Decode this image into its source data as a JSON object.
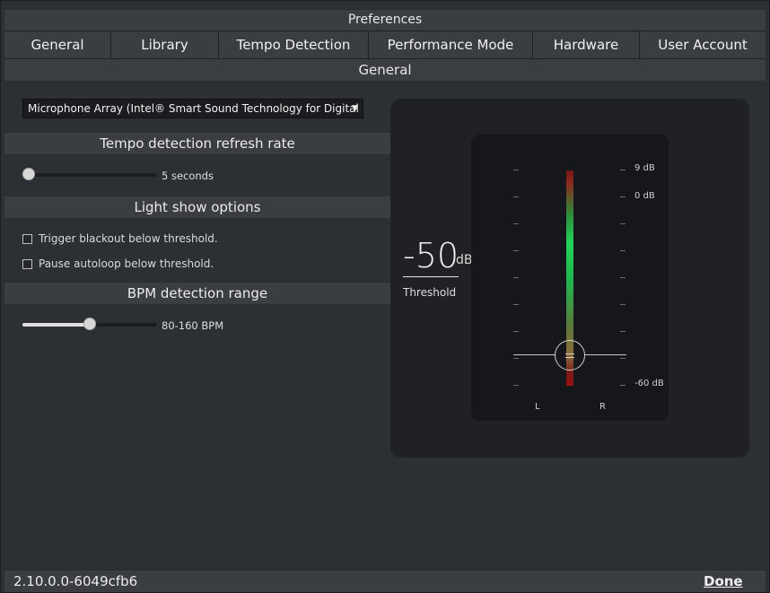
{
  "window_title": "Preferences",
  "tabs": [
    {
      "label": "General"
    },
    {
      "label": "Library"
    },
    {
      "label": "Tempo Detection"
    },
    {
      "label": "Performance Mode"
    },
    {
      "label": "Hardware"
    },
    {
      "label": "User Account"
    }
  ],
  "section_title": "General",
  "input_device": {
    "selected": "Microphone Array (Intel® Smart Sound Technology for Digital Mic...",
    "arrow_icon": "dropdown-arrow-icon"
  },
  "tempo_refresh": {
    "header": "Tempo detection refresh rate",
    "value_label": "5 seconds",
    "fraction": 0.0
  },
  "light_show": {
    "header": "Light show options",
    "options": [
      {
        "label": "Trigger blackout below threshold.",
        "checked": false
      },
      {
        "label": "Pause autoloop below threshold.",
        "checked": false
      }
    ]
  },
  "bpm_range": {
    "header": "BPM detection range",
    "value_label": "80-160 BPM",
    "fraction": 0.5
  },
  "meter": {
    "threshold_value": "-50",
    "threshold_unit": "dB",
    "threshold_label": "Threshold",
    "scale_labels": {
      "top": "9 dB",
      "zero": "0 dB",
      "bottom": "-60 dB"
    },
    "channel_left": "L",
    "channel_right": "R"
  },
  "footer": {
    "version": "2.10.0.0-6049cfb6",
    "done_label": "Done"
  }
}
